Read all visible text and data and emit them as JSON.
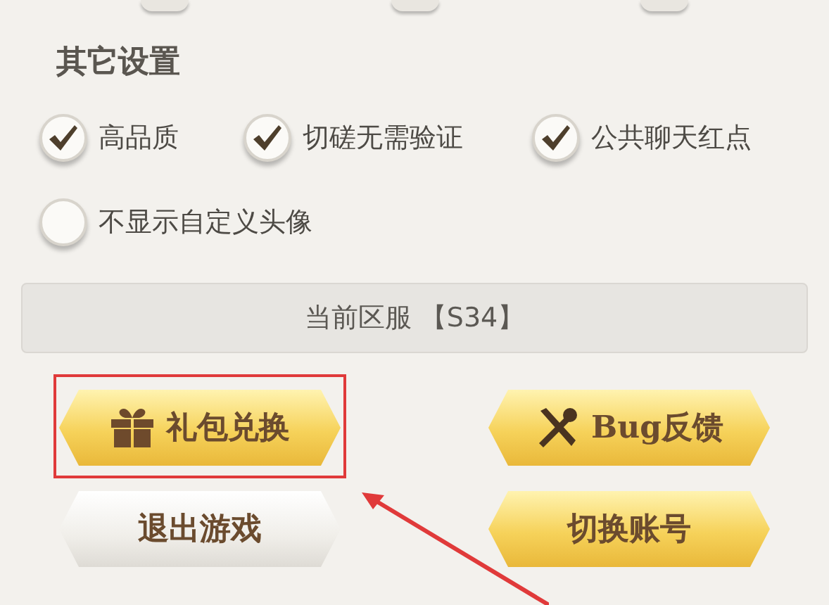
{
  "section_title": "其它设置",
  "options": [
    {
      "label": "高品质",
      "checked": true
    },
    {
      "label": "切磋无需验证",
      "checked": true
    },
    {
      "label": "公共聊天红点",
      "checked": true
    },
    {
      "label": "不显示自定义头像",
      "checked": false
    }
  ],
  "server_bar": "当前区服 【S34】",
  "buttons": [
    {
      "label": "礼包兑换",
      "kind": "gold",
      "highlighted": true
    },
    {
      "label": "Bug反馈",
      "kind": "gold",
      "highlighted": false
    },
    {
      "label": "退出游戏",
      "kind": "silver",
      "highlighted": false
    },
    {
      "label": "切换账号",
      "kind": "gold",
      "highlighted": false
    }
  ]
}
